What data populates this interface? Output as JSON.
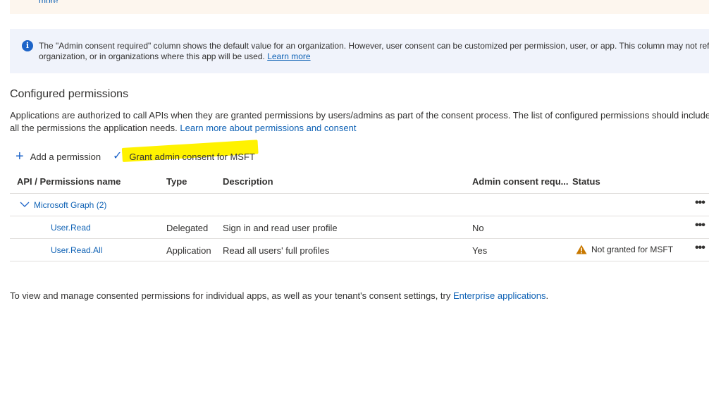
{
  "top_banner": {
    "link_text": "more"
  },
  "info_banner": {
    "line1": "The \"Admin consent required\" column shows the default value for an organization. However, user consent can be customized per permission, user, or app. This column may not reflect the value in your",
    "line2_prefix": "organization, or in organizations where this app will be used.",
    "learn_more": "Learn more"
  },
  "section": {
    "title": "Configured permissions",
    "desc_line1": "Applications are authorized to call APIs when they are granted permissions by users/admins as part of the consent process. The list of configured permissions should include",
    "desc_line2_prefix": "all the permissions the application needs.",
    "desc_link": "Learn more about permissions and consent"
  },
  "toolbar": {
    "add_permission": "Add a permission",
    "grant_consent": "Grant admin consent for MSFT"
  },
  "table": {
    "headers": {
      "name": "API / Permissions name",
      "type": "Type",
      "description": "Description",
      "admin": "Admin consent requ...",
      "status": "Status"
    },
    "group": {
      "label": "Microsoft Graph (2)"
    },
    "rows": [
      {
        "name": "User.Read",
        "type": "Delegated",
        "description": "Sign in and read user profile",
        "admin": "No",
        "status": ""
      },
      {
        "name": "User.Read.All",
        "type": "Application",
        "description": "Read all users' full profiles",
        "admin": "Yes",
        "status": "Not granted for MSFT"
      }
    ],
    "more_glyph": "•••"
  },
  "footer": {
    "prefix": "To view and manage consented permissions for individual apps, as well as your tenant's consent settings, try",
    "link": "Enterprise applications",
    "suffix": "."
  },
  "colors": {
    "link": "#0f62b5",
    "accent": "#1d64c8",
    "highlight": "#fff200",
    "warning": "#c87800"
  }
}
